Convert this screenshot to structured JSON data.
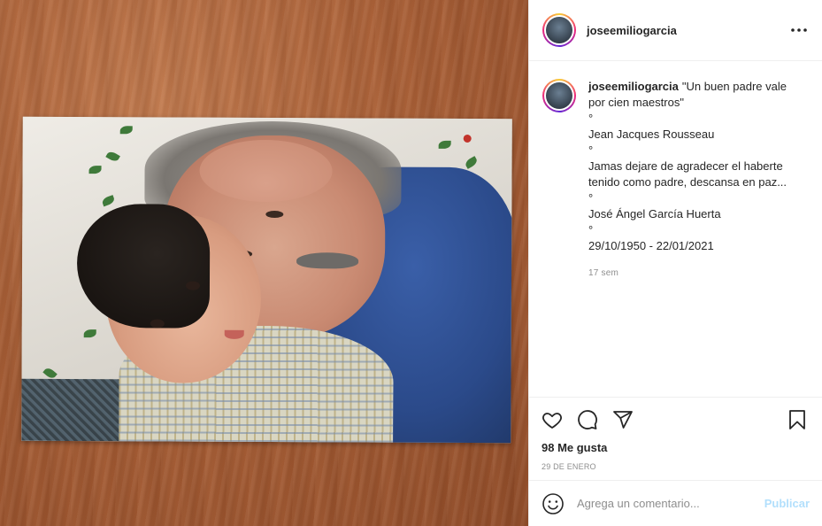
{
  "post": {
    "username": "joseemiliogarcia",
    "more_icon": "more-horizontal-icon"
  },
  "caption": {
    "username": "joseemiliogarcia",
    "lines": [
      "\"Un buen padre vale por cien maestros\"",
      "°",
      "Jean Jacques Rousseau",
      "°",
      "Jamas dejare de agradecer el haberte tenido como padre, descansa en paz...",
      "°",
      "José Ángel García Huerta",
      "°",
      "29/10/1950 - 22/01/2021"
    ],
    "time_ago": "17 sem"
  },
  "actions": {
    "icons": [
      "heart-icon",
      "comment-icon",
      "share-icon",
      "bookmark-icon"
    ],
    "likes": "98 Me gusta",
    "date": "29 DE ENERO"
  },
  "comment": {
    "placeholder": "Agrega un comentario...",
    "publish_label": "Publicar"
  },
  "colors": {
    "text": "#262626",
    "muted": "#8e8e8e",
    "publish_disabled": "#b2dffc",
    "divider": "#efefef"
  }
}
